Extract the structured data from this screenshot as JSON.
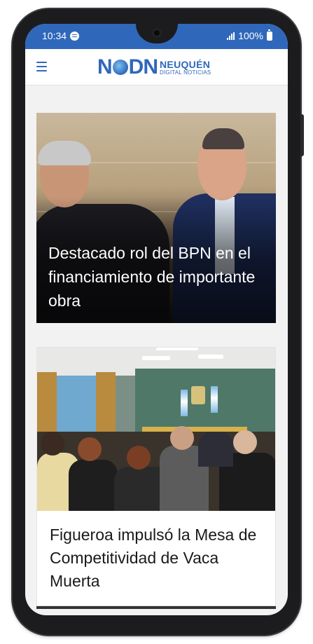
{
  "status_bar": {
    "time": "10:34",
    "battery": "100%",
    "icons": [
      "spotify-icon",
      "signal-icon",
      "battery-icon"
    ]
  },
  "header": {
    "menu_icon": "menu-icon",
    "logo": {
      "mark": "NDN",
      "city": "NEUQUÉN",
      "subtitle": "DIGITAL NOTICIAS"
    }
  },
  "articles": [
    {
      "headline": "Destacado rol del BPN en el financiamiento de importante obra"
    },
    {
      "headline": "Figueroa impulsó la Mesa de Competitividad de Vaca Muerta"
    }
  ],
  "colors": {
    "brand": "#2f68ba",
    "status_bar": "#2f68ba",
    "headline_dark": "#1a1a1a"
  }
}
